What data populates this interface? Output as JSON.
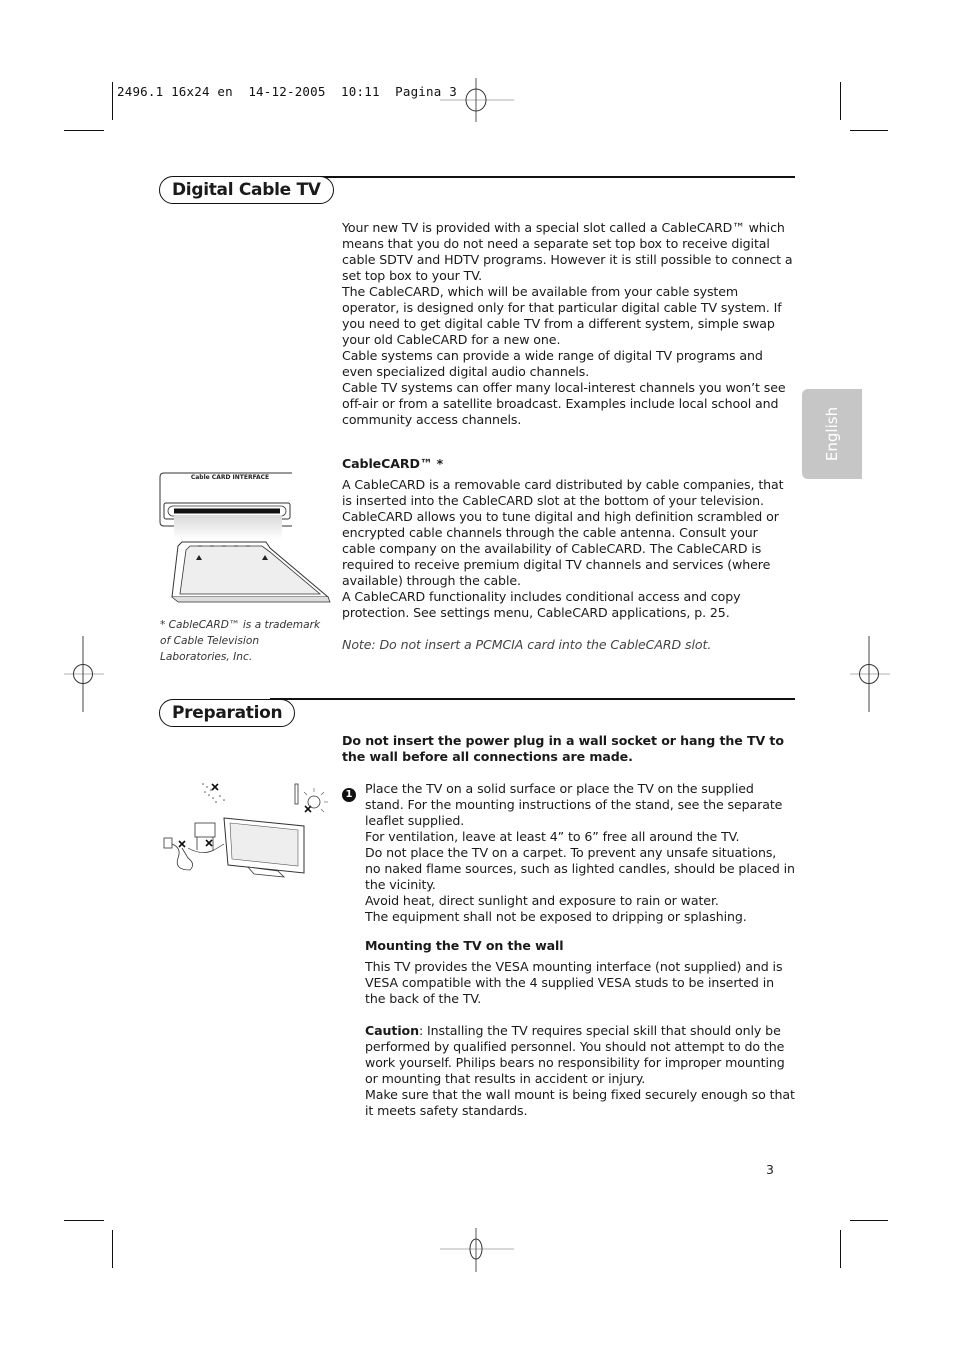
{
  "slug": {
    "text": "2496.1 16x24 en  14-12-2005  10:11  Pagina 3"
  },
  "side_tab": {
    "label": "English"
  },
  "sections": {
    "digital_cable_tv": {
      "title": "Digital Cable TV",
      "intro_paragraphs": [
        "Your new TV is provided with a special slot called a CableCARD™ which means  that you do not need a separate set top box to receive digital cable SDTV and HDTV programs. However it is still possible to connect a set top box to your TV.",
        "The CableCARD, which will be available from your cable system operator, is designed only for that particular digital cable TV system. If you need to get digital cable TV from a different system, simple swap your old CableCARD for a new one.",
        "Cable systems can provide a wide range of digital TV programs and even specialized digital audio channels.",
        "Cable TV systems can offer many local-interest channels you won’t see off-air or from a satellite broadcast. Examples include local school and community access channels."
      ],
      "cablecard_heading": "CableCARD™ *",
      "cablecard_paragraphs": [
        "A CableCARD is a removable card distributed by cable companies, that is inserted into the CableCARD slot at the bottom of your television. CableCARD allows you to tune digital and high definition scrambled or encrypted cable channels through the cable antenna. Consult your cable company on the availability of CableCARD. The CableCARD is required to receive premium digital TV channels and services (where available) through the cable.",
        "A CableCARD functionality includes conditional access and copy protection. See settings menu, CableCARD applications, p. 25."
      ],
      "note": "Note: Do not insert a PCMCIA card into the CableCARD slot.",
      "illustration_label": "Cable CARD INTERFACE",
      "trademark_footnote": "* CableCARD™ is a trademark of Cable Television Laboratories, Inc."
    },
    "preparation": {
      "title": "Preparation",
      "warning": "Do not insert the power plug in a wall socket or hang the TV to the wall before all connections are made.",
      "step_number": "1",
      "step_lines": [
        "Place the TV on a solid surface or place the TV on the supplied stand. For the mounting instructions of the stand, see the separate leaflet supplied.",
        "For ventilation, leave at least 4” to 6” free all around the TV.",
        "Do not place the TV on a carpet. To prevent any unsafe situations, no naked flame sources, such as lighted candles, should be placed in the vicinity.",
        "Avoid heat, direct sunlight and exposure to rain or water.",
        "The equipment shall not be exposed to dripping or splashing."
      ],
      "mounting_heading": "Mounting the TV on the wall",
      "mounting_text": "This TV provides the VESA mounting interface (not supplied) and is VESA compatible with the 4 supplied VESA studs to be inserted in the back of the TV.",
      "caution_label": "Caution",
      "caution_text": ": Installing the TV requires special skill that should only be performed by qualified personnel. You should not attempt to do the work yourself. Philips bears no responsibility for improper mounting or mounting that results in accident or injury.",
      "wall_mount_text": "Make sure that the wall mount is being fixed securely enough so that it meets safety standards."
    }
  },
  "page_number": "3"
}
